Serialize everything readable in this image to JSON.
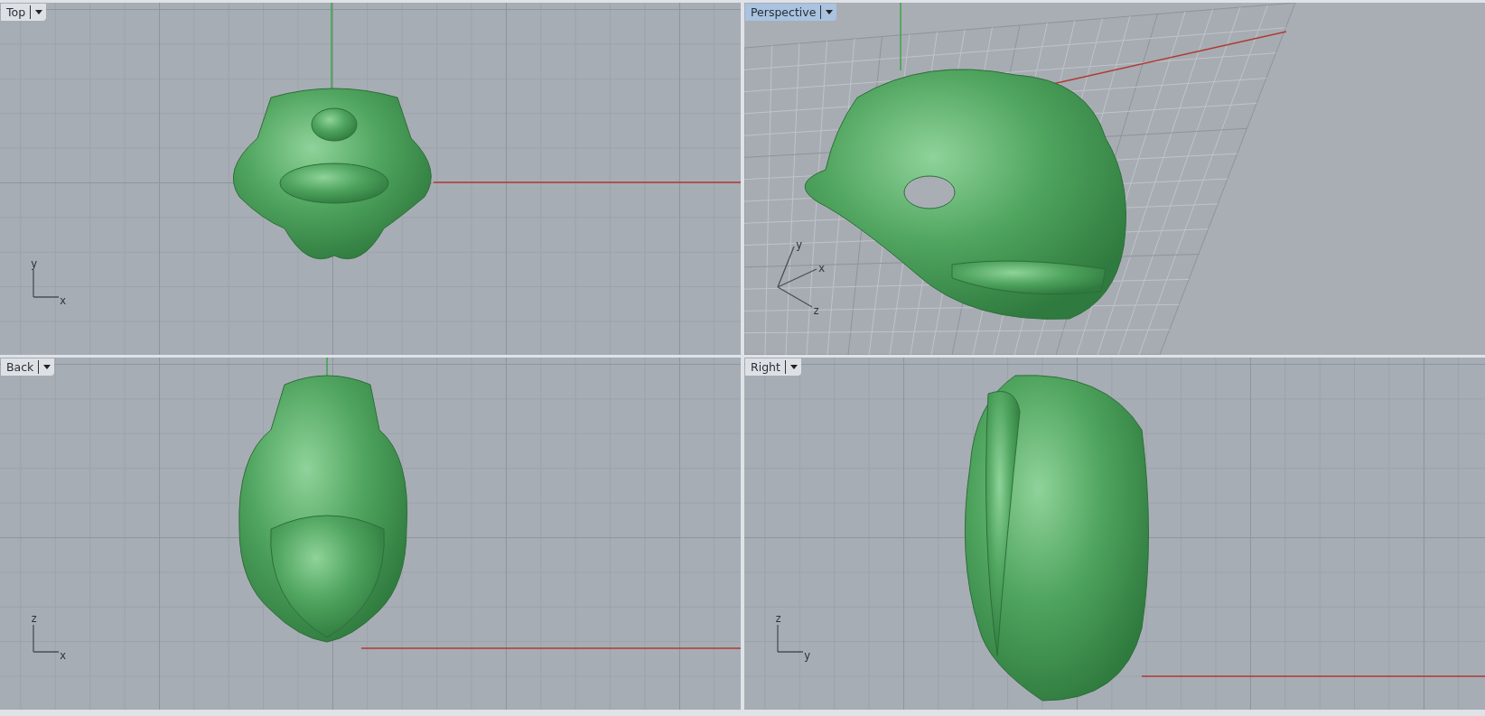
{
  "viewports": [
    {
      "title": "Top",
      "kind": "top",
      "selected": false,
      "axis_labels": [
        "y",
        "x"
      ]
    },
    {
      "title": "Perspective",
      "kind": "perspective",
      "selected": true,
      "axis_labels": [
        "y",
        "x",
        "z"
      ]
    },
    {
      "title": "Back",
      "kind": "back",
      "selected": false,
      "axis_labels": [
        "z",
        "x"
      ]
    },
    {
      "title": "Right",
      "kind": "right",
      "selected": false,
      "axis_labels": [
        "z",
        "y"
      ]
    }
  ]
}
